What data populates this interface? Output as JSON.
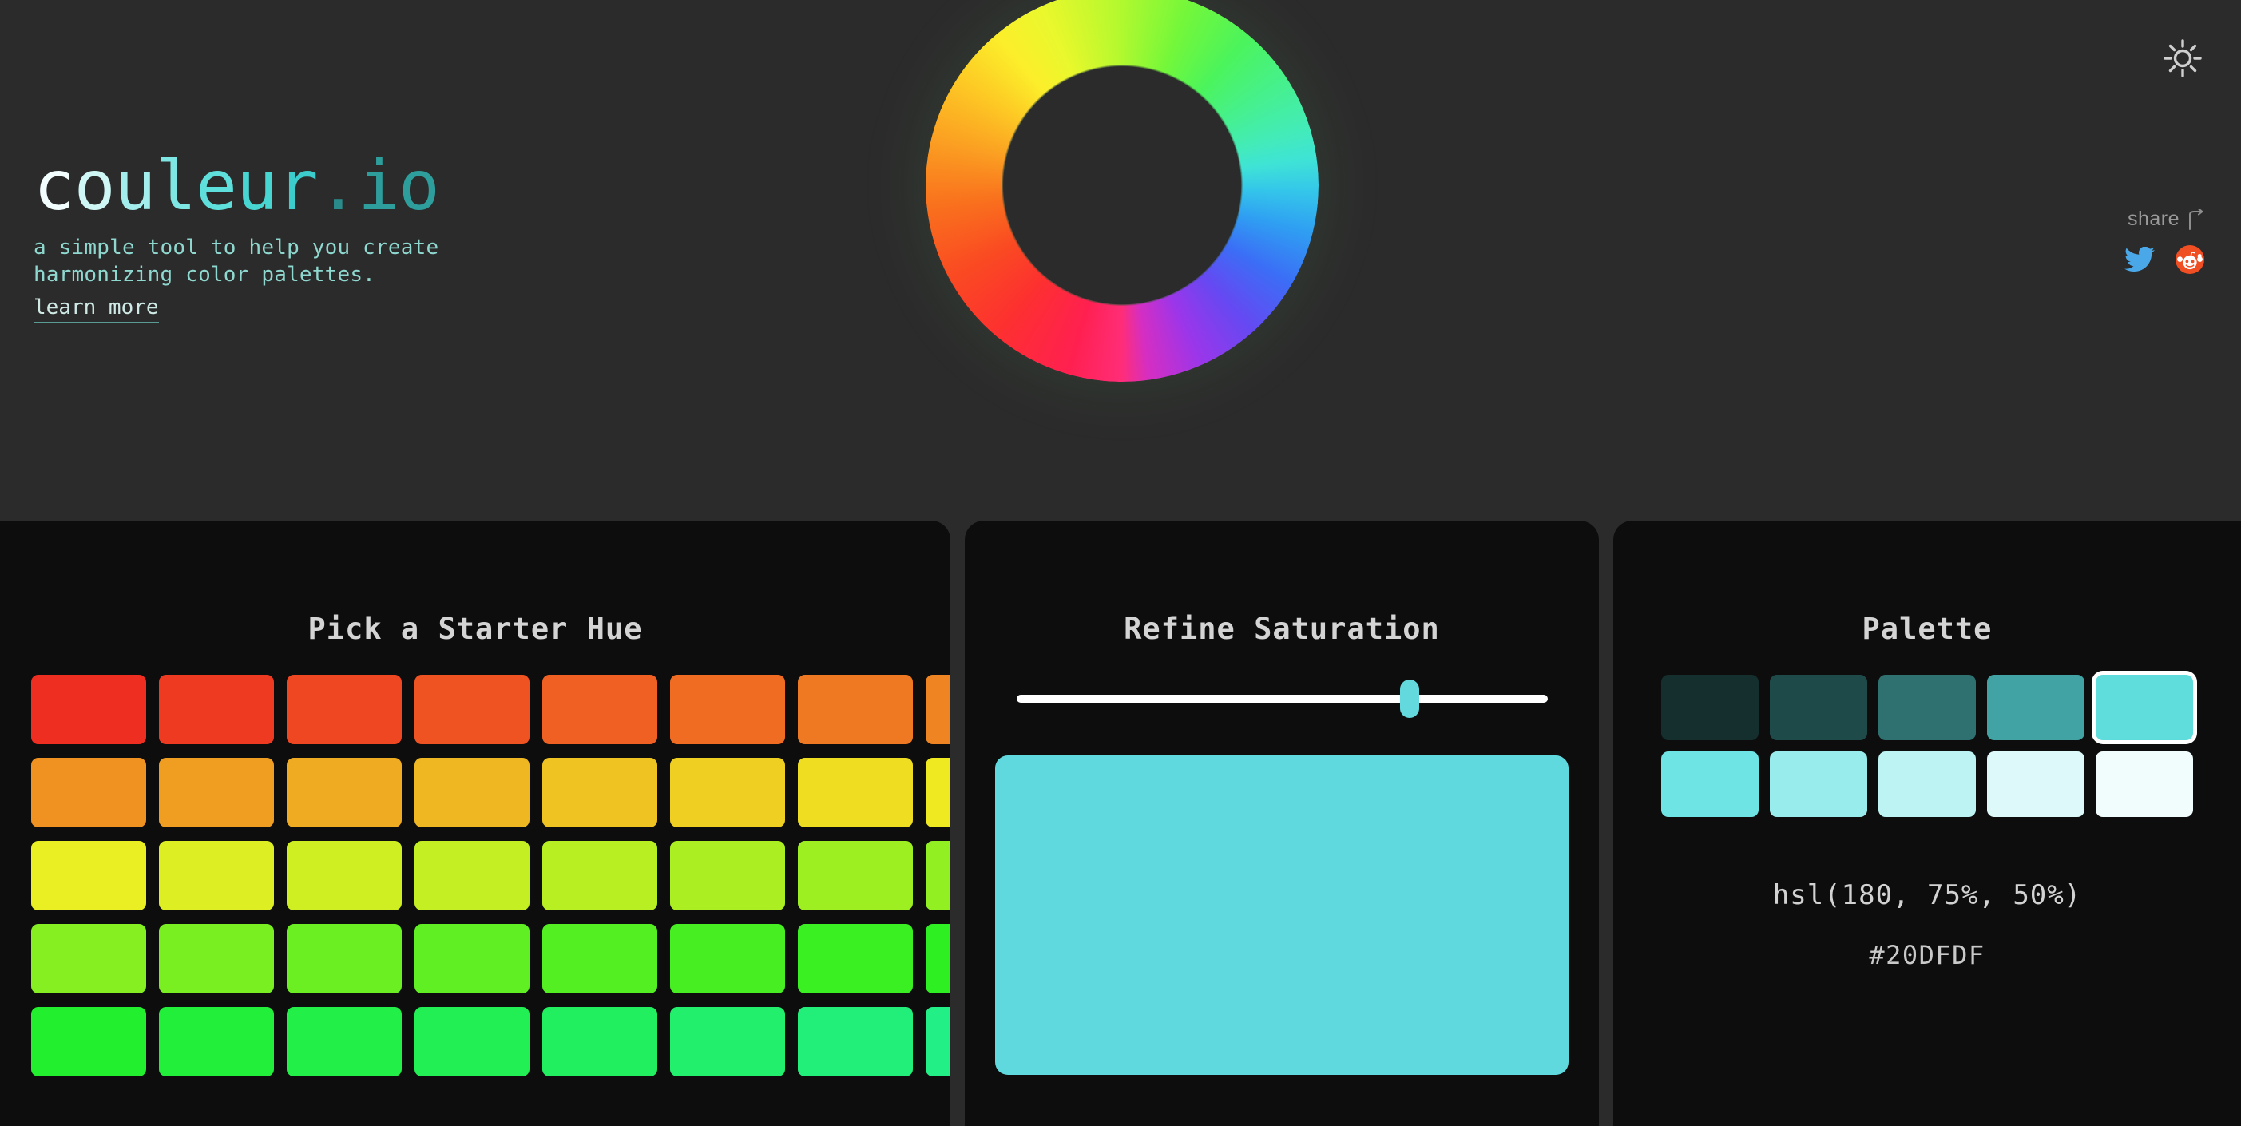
{
  "header": {
    "logo": {
      "name": "couleur",
      "dot": ".",
      "tld": "io",
      "full": "couleur.io"
    },
    "tagline_line1": "a simple tool to help you create",
    "tagline_line2": "harmonizing color palettes.",
    "learn_more": "learn more",
    "theme_toggle_icon": "sun-icon",
    "share": {
      "label": "share",
      "arrow_icon": "share-arrow-icon",
      "twitter_icon": "twitter-icon",
      "reddit_icon": "reddit-icon",
      "twitter_color": "#4aa8e8",
      "reddit_color": "#f04e23"
    },
    "color_wheel_icon": "color-wheel-icon"
  },
  "theme": {
    "page_background": "#2b2b2b",
    "panel_background": "#0d0d0d",
    "accent": "#20DFDF",
    "text_primary": "#d4d4d4",
    "text_muted": "#9a9a9a",
    "logo_accent": "#5fdfdc"
  },
  "panels": {
    "hue": {
      "title": "Pick a Starter Hue",
      "columns": 8,
      "rows": 5,
      "swatches": [
        "#ef2e22",
        "#ef3a22",
        "#ef4722",
        "#ef5322",
        "#ef6022",
        "#ef6c22",
        "#ef7922",
        "#ef8522",
        "#ef9222",
        "#ef9e22",
        "#efab22",
        "#efb722",
        "#efc422",
        "#efd022",
        "#efdd22",
        "#efe922",
        "#e9ef22",
        "#ddef22",
        "#d0ef22",
        "#c4ef22",
        "#b7ef22",
        "#abef22",
        "#9eef22",
        "#92ef22",
        "#85ef22",
        "#79ef22",
        "#6cef22",
        "#60ef22",
        "#53ef22",
        "#47ef22",
        "#3aef22",
        "#2eef22",
        "#22ef2e",
        "#22ef3a",
        "#22ef47",
        "#22ef53",
        "#22ef60",
        "#22ef6c",
        "#22ef79",
        "#22ef85"
      ]
    },
    "saturation": {
      "title": "Refine Saturation",
      "slider": {
        "name": "saturation-slider",
        "value_percent": 74,
        "min": 0,
        "max": 100,
        "track_color": "#ffffff",
        "thumb_color": "#63d9dd"
      },
      "preview_color": "#5fd8de"
    },
    "palette": {
      "title": "Palette",
      "selected_index": 4,
      "swatches": [
        "#152e2e",
        "#1f4a4a",
        "#2f7070",
        "#41a3a3",
        "#5fdcdc",
        "#6fe4e4",
        "#98ecec",
        "#bdf3f3",
        "#ddf9f9",
        "#f1fcfc"
      ],
      "hsl_value": "hsl(180, 75%, 50%)",
      "hex_value": "#20DFDF"
    }
  }
}
